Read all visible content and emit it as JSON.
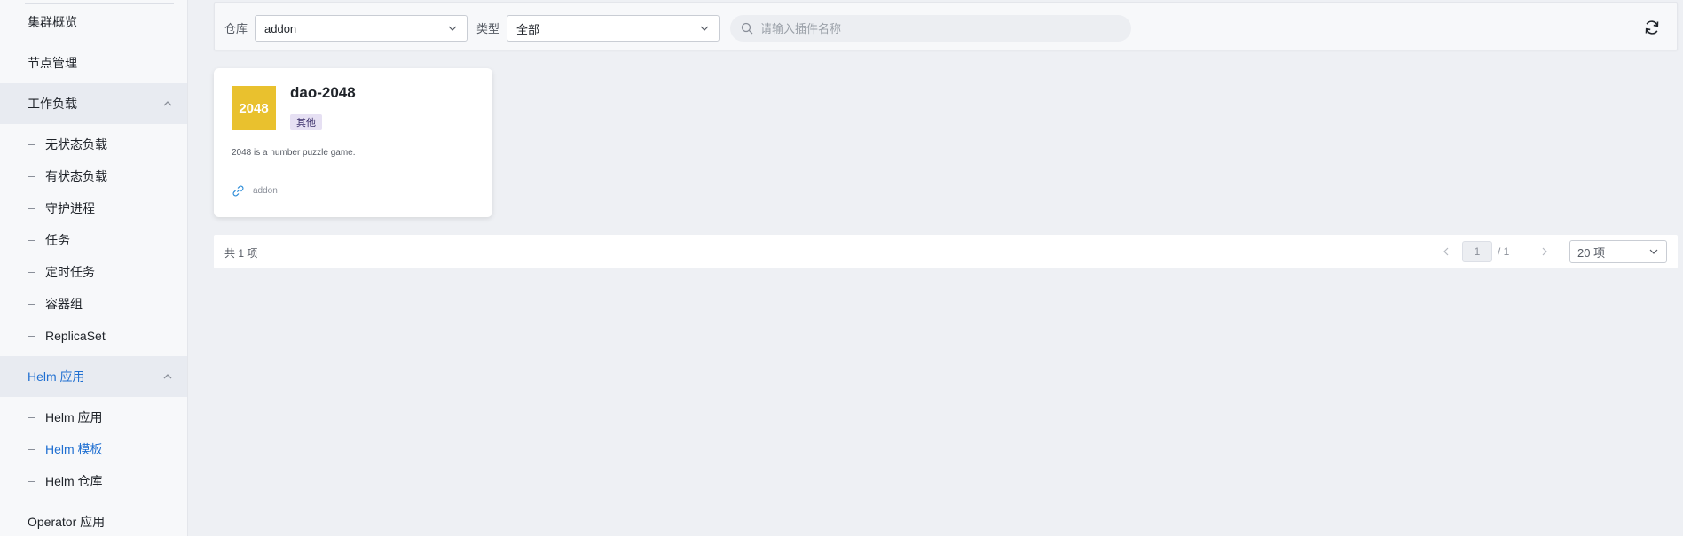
{
  "sidebar": {
    "top_items": [
      "集群概览",
      "节点管理"
    ],
    "workload_group": {
      "label": "工作负载",
      "items": [
        "无状态负载",
        "有状态负载",
        "守护进程",
        "任务",
        "定时任务",
        "容器组",
        "ReplicaSet"
      ]
    },
    "helm_group": {
      "label": "Helm 应用",
      "items": [
        "Helm 应用",
        "Helm 模板",
        "Helm 仓库"
      ],
      "active_item": "Helm 模板"
    },
    "bottom_item": "Operator 应用"
  },
  "toolbar": {
    "repo_label": "仓库",
    "repo_value": "addon",
    "type_label": "类型",
    "type_value": "全部",
    "search_placeholder": "请输入插件名称",
    "refresh_icon": "refresh-icon"
  },
  "cards": [
    {
      "logo_text": "2048",
      "logo_color": "#e9c12e",
      "title": "dao-2048",
      "tag": "其他",
      "description": "2048 is a number puzzle game.",
      "repo": "addon"
    }
  ],
  "pagination": {
    "total_text": "共 1 项",
    "current_page": "1",
    "total_pages": "/ 1",
    "page_size": "20 项"
  },
  "colors": {
    "accent": "#1f6fd1",
    "sidebar_bg": "#f7f8fa",
    "page_bg": "#eef0f4"
  }
}
